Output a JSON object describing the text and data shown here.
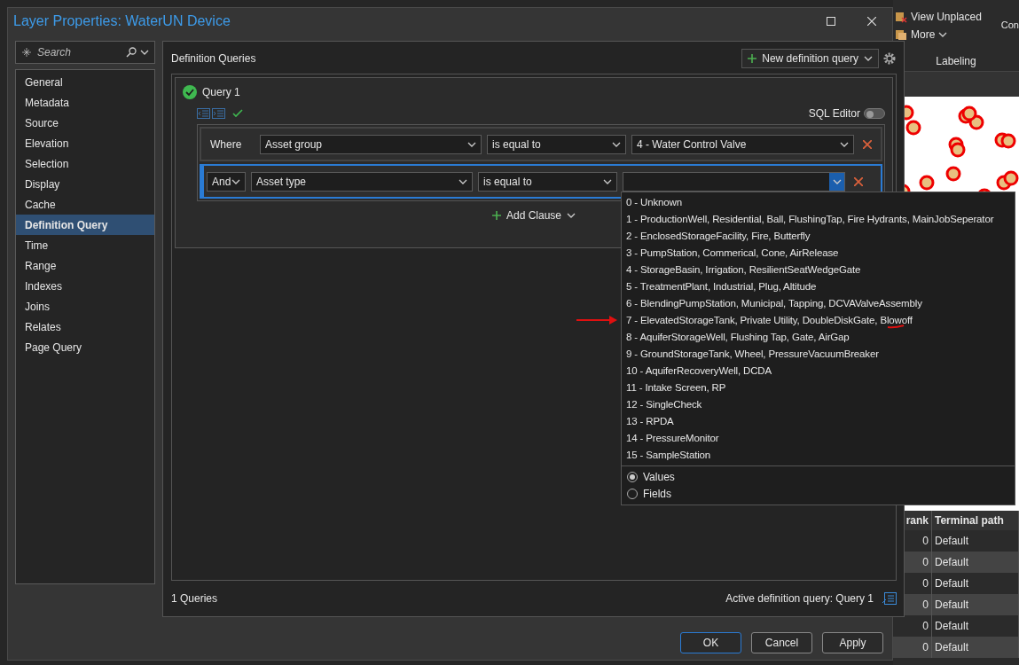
{
  "background_app": {
    "ribbon": {
      "buttons": [
        "View Unplaced",
        "More"
      ],
      "group_label": "Labeling",
      "cut_label": "Con"
    },
    "table": {
      "columns": [
        "rank",
        "Terminal path"
      ],
      "rows": [
        [
          "0",
          "Default"
        ],
        [
          "0",
          "Default"
        ],
        [
          "0",
          "Default"
        ],
        [
          "0",
          "Default"
        ],
        [
          "0",
          "Default"
        ],
        [
          "0",
          "Default"
        ]
      ]
    }
  },
  "window": {
    "title": "Layer Properties: WaterUN Device"
  },
  "search": {
    "placeholder": "Search"
  },
  "sidebar": {
    "items": [
      {
        "label": "General",
        "selected": false
      },
      {
        "label": "Metadata",
        "selected": false
      },
      {
        "label": "Source",
        "selected": false
      },
      {
        "label": "Elevation",
        "selected": false
      },
      {
        "label": "Selection",
        "selected": false
      },
      {
        "label": "Display",
        "selected": false
      },
      {
        "label": "Cache",
        "selected": false
      },
      {
        "label": "Definition Query",
        "selected": true
      },
      {
        "label": "Time",
        "selected": false
      },
      {
        "label": "Range",
        "selected": false
      },
      {
        "label": "Indexes",
        "selected": false
      },
      {
        "label": "Joins",
        "selected": false
      },
      {
        "label": "Relates",
        "selected": false
      },
      {
        "label": "Page Query",
        "selected": false
      }
    ]
  },
  "panel": {
    "title": "Definition Queries",
    "new_query_button": "New definition query",
    "query": {
      "name": "Query 1",
      "valid": true,
      "sql_editor": {
        "label": "SQL Editor",
        "on": false
      },
      "clauses": [
        {
          "kind": "label",
          "connector": "Where",
          "field": "Asset group",
          "operator": "is equal to",
          "value": "4 - Water Control Valve",
          "active": false
        },
        {
          "kind": "dropdown",
          "connector": "And",
          "field": "Asset type",
          "operator": "is equal to",
          "active": true
        }
      ],
      "add_clause": "Add Clause"
    },
    "count": "1 Queries",
    "active_query": "Active definition query: Query 1"
  },
  "dropdown": {
    "items": [
      "0 - Unknown",
      "1 - ProductionWell, Residential, Ball, FlushingTap, Fire Hydrants, MainJobSeperator",
      "2 - EnclosedStorageFacility, Fire, Butterfly",
      "3 - PumpStation, Commerical, Cone, AirRelease",
      "4 - StorageBasin, Irrigation, ResilientSeatWedgeGate",
      "5 - TreatmentPlant, Industrial, Plug, Altitude",
      "6 - BlendingPumpStation, Municipal, Tapping, DCVAValveAssembly",
      "7 - ElevatedStorageTank, Private Utility, DoubleDiskGate, Blowoff",
      "8 - AquiferStorageWell, Flushing Tap, Gate, AirGap",
      "9 - GroundStorageTank, Wheel, PressureVacuumBreaker",
      "10 - AquiferRecoveryWell, DCDA",
      "11 - Intake Screen, RP",
      "12 - SingleCheck",
      "13 - RPDA",
      "14 - PressureMonitor",
      "15 - SampleStation"
    ],
    "modes": [
      {
        "label": "Values",
        "selected": true
      },
      {
        "label": "Fields",
        "selected": false
      }
    ]
  },
  "buttons": [
    {
      "label": "OK",
      "default": true
    },
    {
      "label": "Cancel",
      "default": false
    },
    {
      "label": "Apply",
      "default": false
    }
  ]
}
